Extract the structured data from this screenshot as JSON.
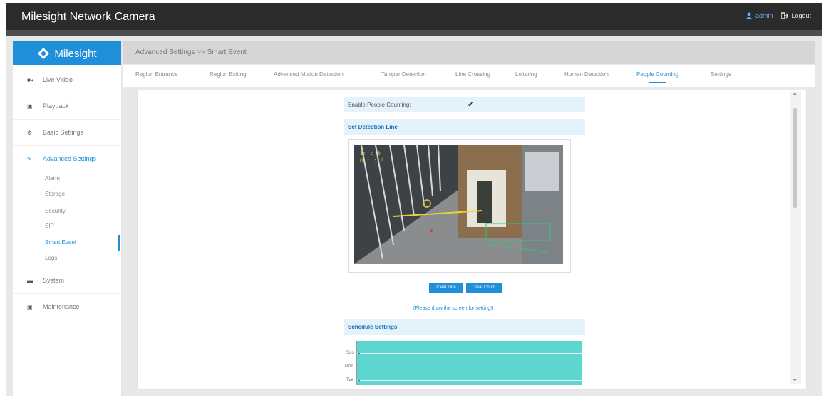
{
  "app": {
    "title": "Milesight Network Camera"
  },
  "user": {
    "name": "admin",
    "logout_label": "Logout"
  },
  "sidebar": {
    "logo_text": "Milesight",
    "items": [
      {
        "label": "Live Video",
        "icon": "video-camera-icon"
      },
      {
        "label": "Playback",
        "icon": "film-icon"
      },
      {
        "label": "Basic Settings",
        "icon": "gear-icon"
      },
      {
        "label": "Advanced Settings",
        "icon": "wrench-icon"
      },
      {
        "label": "System",
        "icon": "monitor-icon"
      },
      {
        "label": "Maintenance",
        "icon": "toolbox-icon"
      }
    ],
    "subitems": [
      "Alarm",
      "Storage",
      "Security",
      "SIP",
      "Smart Event",
      "Logs"
    ],
    "active_subitem": "Smart Event"
  },
  "breadcrumb": "Advanced Settings >> Smart Event",
  "tabs": [
    "Region Entrance",
    "Region Exiting",
    "Advanced Motion Detection",
    "Tamper Detection",
    "Line Crossing",
    "Loitering",
    "Human Detection",
    "People Counting",
    "Settings"
  ],
  "active_tab": "People Counting",
  "form": {
    "enable_label": "Enable People Counting:",
    "enable_checked": true,
    "check_glyph": "✔",
    "detection_header": "Set Detection Line",
    "clear_line_label": "Clear Line",
    "clear_count_label": "Clear Count",
    "hint": "(Please draw the screen for setting!)",
    "schedule_header": "Schedule Settings",
    "days": [
      "Sun",
      "Mon",
      "Tue"
    ]
  },
  "video_overlay": {
    "in_label": "In : 0",
    "out_label": "Out : 0"
  },
  "colors": {
    "accent": "#1e8fd8",
    "topbar": "#2b2b2b",
    "schedule_fill": "#5cd6cf",
    "row_bg": "#e3f2fb"
  }
}
